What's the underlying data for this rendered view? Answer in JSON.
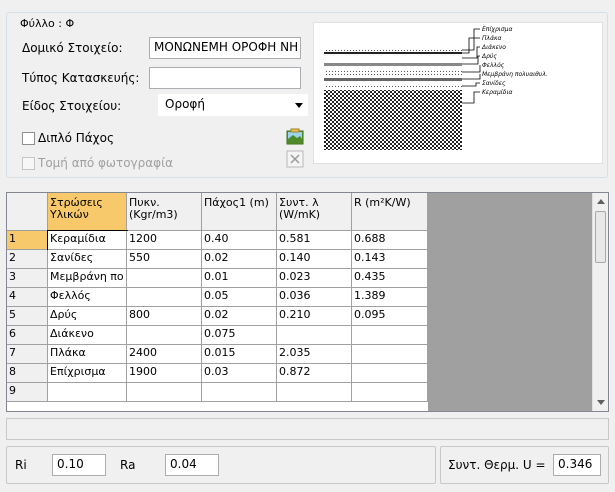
{
  "group": {
    "title": "Φύλλο : Φ"
  },
  "form": {
    "element_label": "Δομικό Στοιχείο:",
    "element_value": "ΜΟΝΩΝΕΜΗ ΟΡΟΦΗ ΝΗ",
    "construction_label": "Τύπος Κατασκευής:",
    "construction_value": "",
    "kind_label": "Είδος Στοιχείου:",
    "kind_value": "Οροφή",
    "double_thickness_label": "Διπλό Πάχος",
    "photo_section_label": "Τομή από φωτογραφία"
  },
  "diagram_labels": [
    "Επίχρισμα",
    "Πλάκα",
    "Διάκενο",
    "Δρύς",
    "Φελλός",
    "Μεμβράνη πολυαιθυλ.",
    "Σανίδες",
    "Κεραμίδια"
  ],
  "table": {
    "headers": [
      "Στρώσεις Υλικών",
      "Πυκν. (Kgr/m3)",
      "Πάχος1 (m)",
      "Συντ. λ (W/mK)",
      "R (m²K/W)"
    ],
    "rows": [
      {
        "n": "1",
        "c": [
          "Κεραμίδια",
          "1200",
          "0.40",
          "0.581",
          "0.688"
        ]
      },
      {
        "n": "2",
        "c": [
          "Σανίδες",
          "550",
          "0.02",
          "0.140",
          "0.143"
        ]
      },
      {
        "n": "3",
        "c": [
          "Μεμβράνη πο",
          "",
          "0.01",
          "0.023",
          "0.435"
        ]
      },
      {
        "n": "4",
        "c": [
          "Φελλός",
          "",
          "0.05",
          "0.036",
          "1.389"
        ]
      },
      {
        "n": "5",
        "c": [
          "Δρύς",
          "800",
          "0.02",
          "0.210",
          "0.095"
        ]
      },
      {
        "n": "6",
        "c": [
          "Διάκενο",
          "",
          "0.075",
          "",
          ""
        ]
      },
      {
        "n": "7",
        "c": [
          "Πλάκα",
          "2400",
          "0.015",
          "2.035",
          ""
        ]
      },
      {
        "n": "8",
        "c": [
          "Επίχρισμα",
          "1900",
          "0.03",
          "0.872",
          ""
        ]
      },
      {
        "n": "9",
        "c": [
          "",
          "",
          "",
          "",
          ""
        ]
      }
    ]
  },
  "bottom": {
    "ri_label": "Ri",
    "ri_value": "0.10",
    "ra_label": "Ra",
    "ra_value": "0.04",
    "u_label": "Συντ. Θερμ. U =",
    "u_value": "0.346"
  },
  "colors": {
    "selected_header": "#f7c96a",
    "grid_gray": "#a0a0a0"
  }
}
